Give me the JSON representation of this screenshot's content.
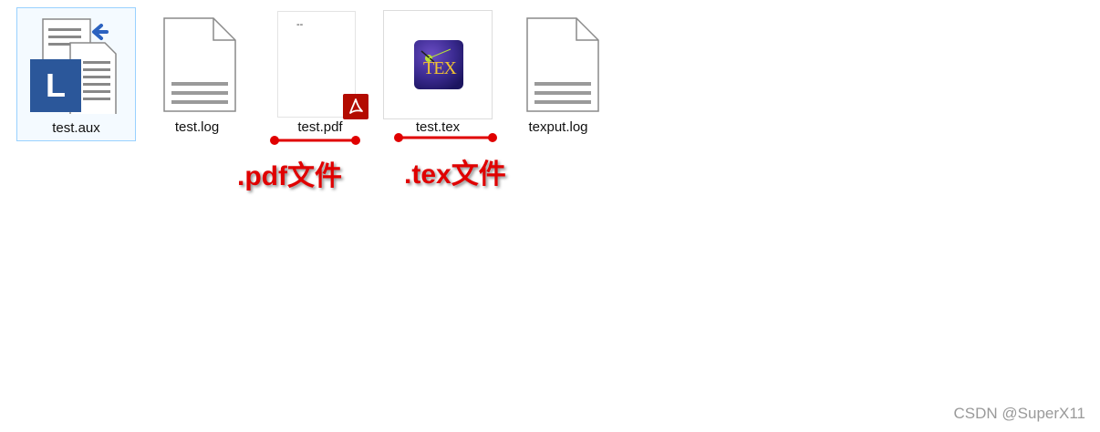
{
  "files": [
    {
      "name": "test.aux",
      "icon": "latex-aux-file-icon",
      "selected": true
    },
    {
      "name": "test.log",
      "icon": "text-document-icon",
      "selected": false
    },
    {
      "name": "test.pdf",
      "icon": "pdf-file-icon",
      "selected": false
    },
    {
      "name": "test.tex",
      "icon": "tex-file-icon",
      "selected": false
    },
    {
      "name": "texput.log",
      "icon": "text-document-icon",
      "selected": false
    }
  ],
  "annotations": {
    "pdf": ".pdf文件",
    "tex": ".tex文件"
  },
  "aux_icon_letter": "L",
  "tex_logo_text": "TEX",
  "pdf_page_mark": "--",
  "watermark": "CSDN @SuperX11",
  "colors": {
    "annotation_red": "#e00000",
    "selection_border": "#99d1ff",
    "aux_blue": "#2b579a",
    "pdf_red": "#b30b00"
  }
}
